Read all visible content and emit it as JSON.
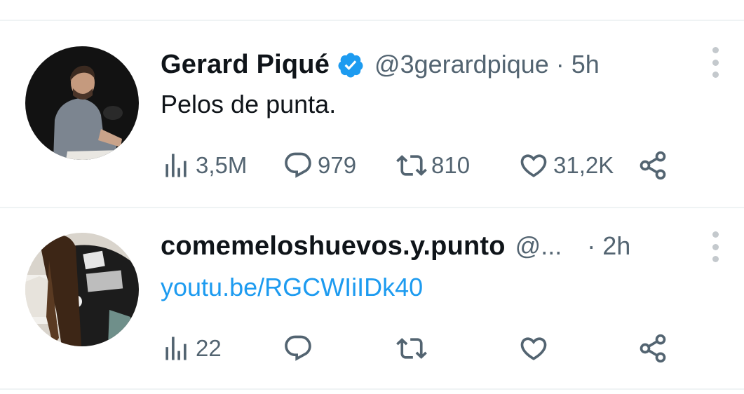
{
  "tweets": [
    {
      "author_name": "Gerard Piqué",
      "verified": true,
      "handle": "@3gerardpique",
      "separator": "·",
      "time": "5h",
      "text": "Pelos de punta.",
      "text_is_link": false,
      "stats": {
        "views": "3,5M",
        "replies": "979",
        "retweets": "810",
        "likes": "31,2K"
      }
    },
    {
      "author_name": "comemeloshuevos.y.punto",
      "verified": false,
      "handle": "@...",
      "separator": "·",
      "time": "2h",
      "text": "youtu.be/RGCWIiIDk40",
      "text_is_link": true,
      "stats": {
        "views": "22",
        "replies": "",
        "retweets": "",
        "likes": ""
      }
    }
  ],
  "icons": {
    "views": "bar-chart-icon",
    "reply": "speech-bubble-icon",
    "retweet": "retweet-icon",
    "like": "heart-icon",
    "share": "share-icon",
    "more": "more-vertical-icon",
    "verified": "verified-badge-icon"
  },
  "colors": {
    "text_primary": "#0f1419",
    "text_secondary": "#536471",
    "link": "#1d9bf0",
    "verified": "#1d9bf0",
    "divider": "#eff3f4"
  }
}
